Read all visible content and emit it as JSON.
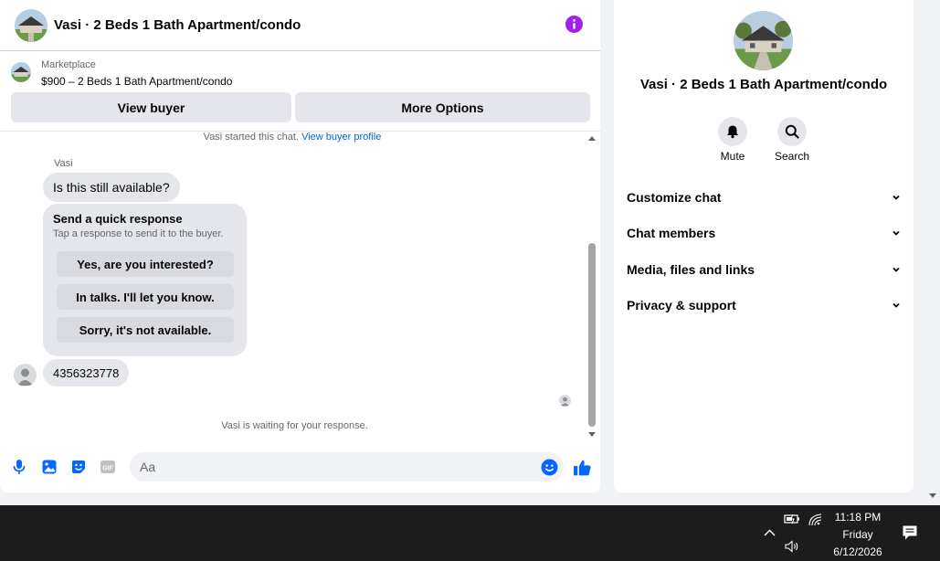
{
  "chat": {
    "title": "Vasi · 2 Beds 1 Bath Apartment/condo",
    "listing": {
      "kind": "Marketplace",
      "price_title": "$900 – 2 Beds 1 Bath Apartment/condo"
    },
    "buttons": {
      "view_buyer": "View buyer",
      "more_options": "More Options"
    },
    "started_text": "Vasi started this chat.",
    "view_profile_link": "View buyer profile",
    "sender": "Vasi",
    "messages": [
      {
        "from": "Vasi",
        "text": "Is this still available?"
      },
      {
        "from": "Vasi",
        "text": "4356323778"
      }
    ],
    "quick_response": {
      "title": "Send a quick response",
      "subtitle": "Tap a response to send it to the buyer.",
      "options": [
        "Yes, are you interested?",
        "In talks. I'll let you know.",
        "Sorry, it's not available."
      ]
    },
    "waiting_text": "Vasi is waiting for your response.",
    "composer": {
      "placeholder": "Aa"
    },
    "colors": {
      "accent": "#0866ff",
      "info": "#a020f0",
      "bubble": "#e4e6eb"
    }
  },
  "side": {
    "title": "Vasi · 2 Beds 1 Bath Apartment/condo",
    "actions": [
      "Mute",
      "Search"
    ],
    "sections": [
      "Customize chat",
      "Chat members",
      "Media, files and links",
      "Privacy & support"
    ]
  },
  "taskbar": {
    "time": "11:18 PM",
    "day": "Friday",
    "date": "6/12/2026",
    "icons": [
      "chevron-up-icon",
      "battery-icon",
      "wifi-icon",
      "volume-icon",
      "notification-icon"
    ]
  }
}
